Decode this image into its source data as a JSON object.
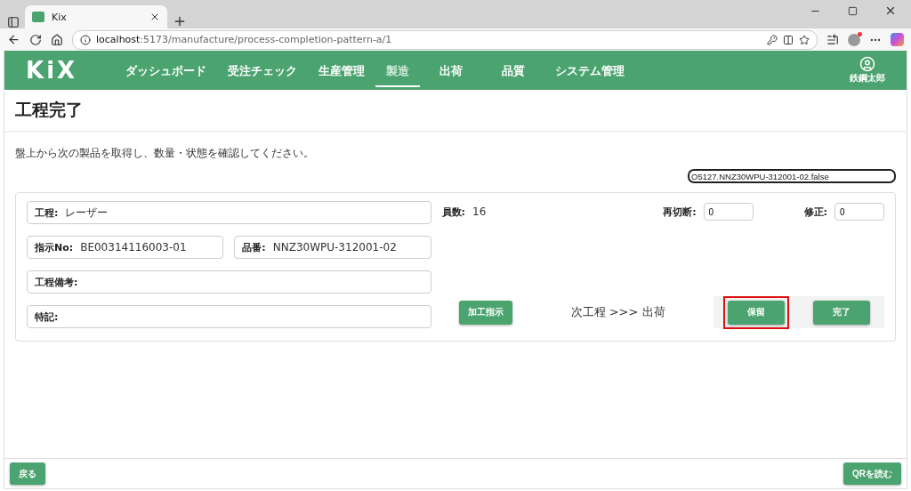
{
  "browser": {
    "tab_title": "Kix",
    "url_host": "localhost",
    "url_path": ":5173/manufacture/process-completion-pattern-a/1"
  },
  "header": {
    "logo": "KiX",
    "user": "鉄鋼太郎",
    "nav": [
      {
        "label": "ダッシュボード",
        "selected": false
      },
      {
        "label": "受注チェック",
        "selected": false
      },
      {
        "label": "生産管理",
        "selected": false
      },
      {
        "label": "製造",
        "selected": true
      },
      {
        "label": "出荷",
        "selected": false
      },
      {
        "label": "品質",
        "selected": false
      },
      {
        "label": "システム管理",
        "selected": false
      }
    ]
  },
  "page": {
    "title": "工程完了",
    "instruction": "盤上から次の製品を取得し、数量・状態を確認してください。",
    "scan_value": "O5127.NNZ30WPU-312001-02.false"
  },
  "fields": {
    "process": {
      "label": "工程:",
      "value": "レーザー"
    },
    "order_no": {
      "label": "指示No:",
      "value": "BE00314116003-01"
    },
    "part_no": {
      "label": "品番:",
      "value": "NNZ30WPU-312001-02"
    },
    "process_remarks": {
      "label": "工程備考:"
    },
    "notes": {
      "label": "特記:"
    }
  },
  "count": {
    "label": "員数:",
    "value": "16"
  },
  "recut": {
    "label": "再切断:",
    "value": "0"
  },
  "correction": {
    "label": "修正:",
    "value": "0"
  },
  "work_instruction_button": "加工指示",
  "next_process": "次工程 >>> 出荷",
  "actions": [
    {
      "label": "保留",
      "highlighted": true
    },
    {
      "label": "完了",
      "highlighted": false
    }
  ],
  "footer": {
    "back": "戻る",
    "qr": "QRを読む"
  }
}
